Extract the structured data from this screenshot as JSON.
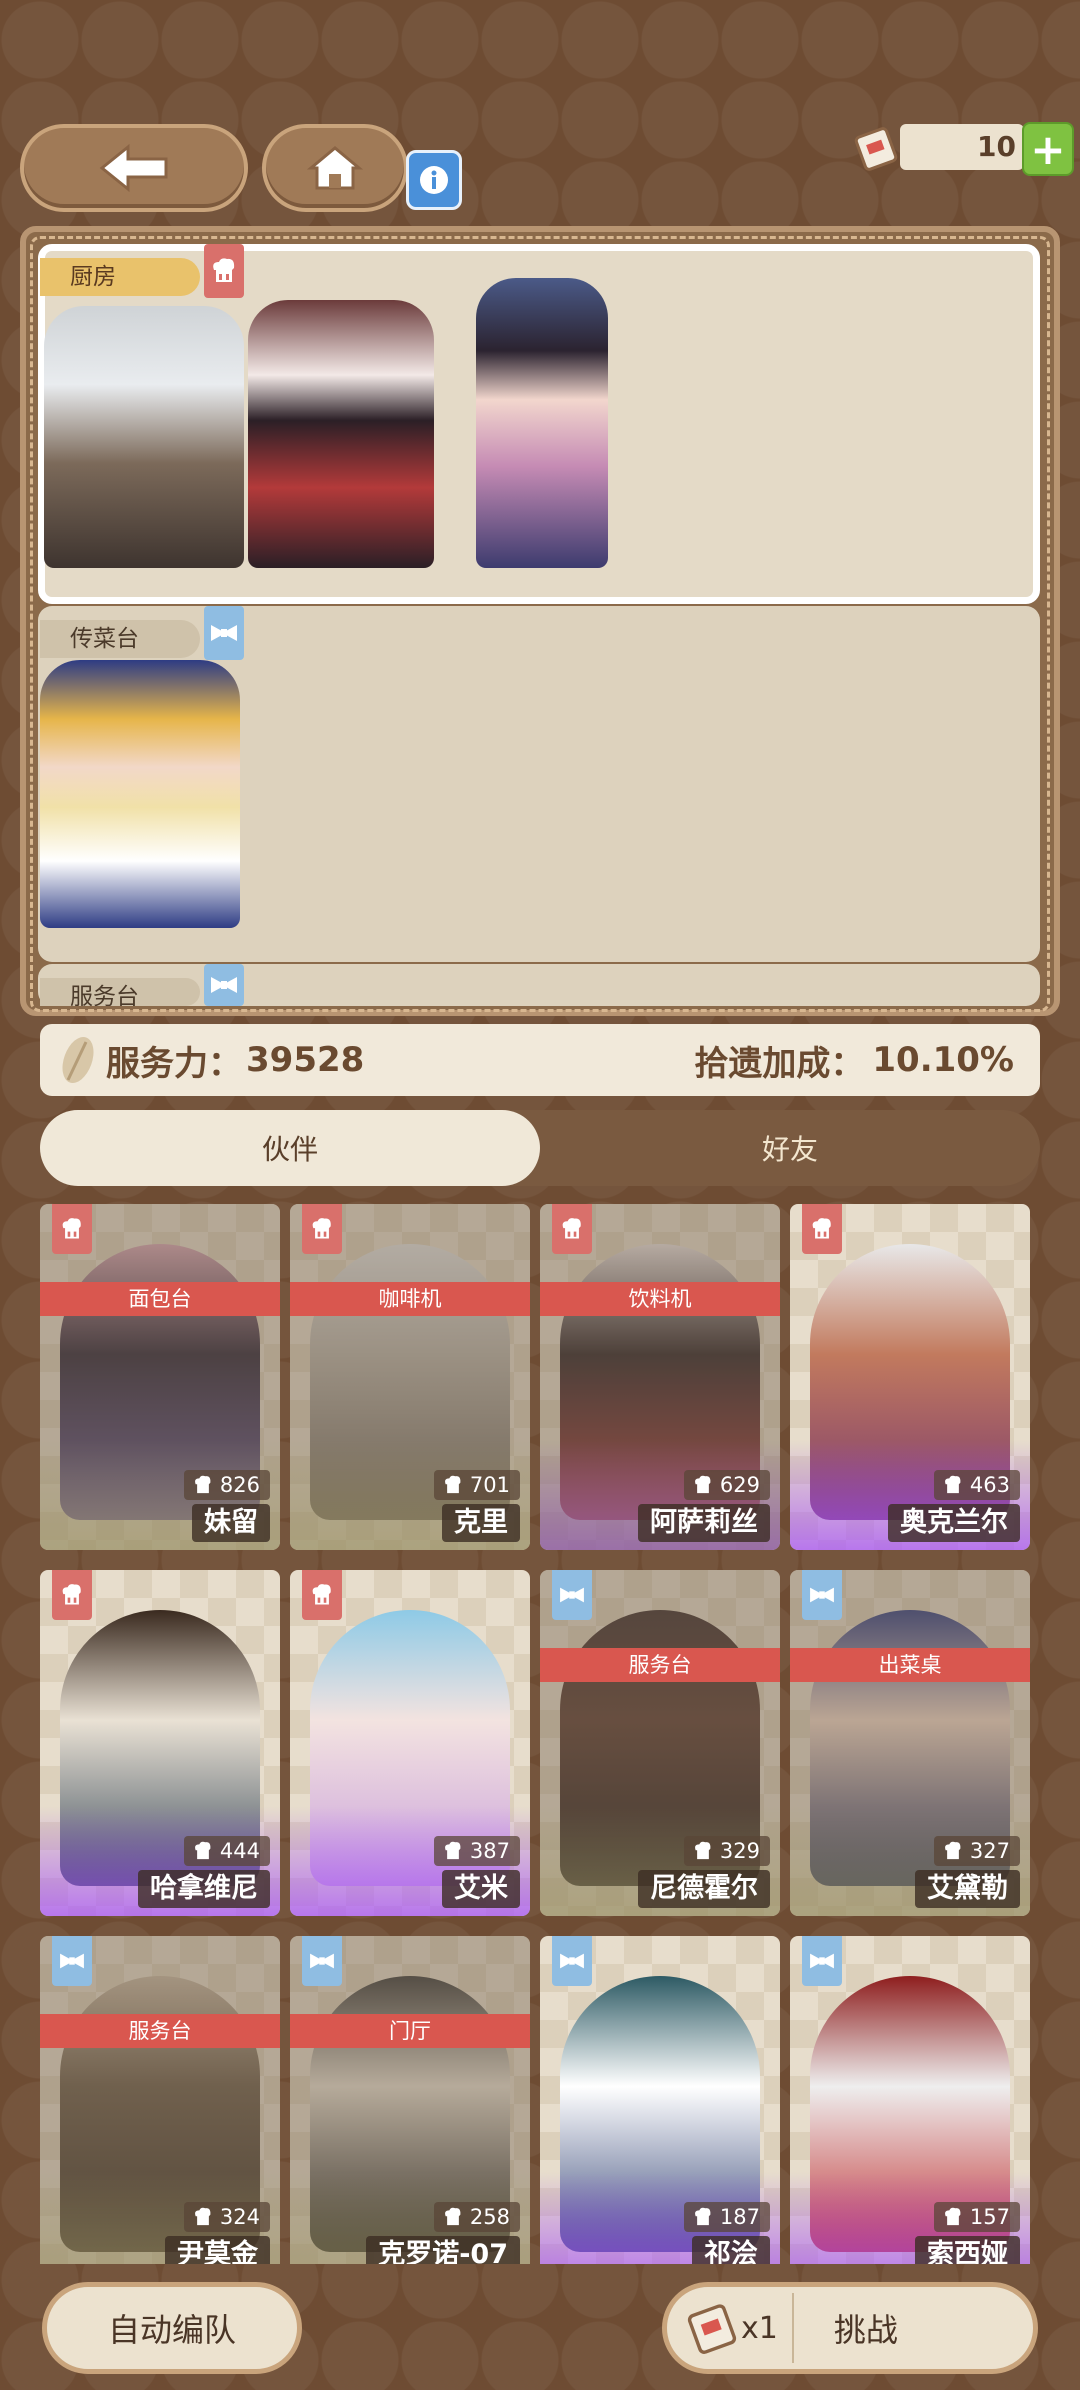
{
  "colors": {
    "accent_red": "#d9574f",
    "accent_blue": "#8fbde2",
    "bg_brown": "#6e4c33",
    "plus_green": "#7fc241"
  },
  "header": {
    "back_icon": "back-arrow-icon",
    "home_icon": "home-icon",
    "info_icon": "info-icon",
    "ticket_icon": "ticket-icon",
    "ticket_count": "10",
    "plus_label": "+"
  },
  "stations": [
    {
      "name": "厨房",
      "icon": "chef-hat-icon",
      "selected": true
    },
    {
      "name": "传菜台",
      "icon": "bowtie-icon",
      "selected": false
    },
    {
      "name": "服务台",
      "icon": "bowtie-icon",
      "selected": false
    }
  ],
  "stats": {
    "service_label": "服务力：",
    "service_value": "39528",
    "bonus_label": "拾遗加成：",
    "bonus_value": "10.10%"
  },
  "tabs": [
    {
      "label": "伙伴",
      "active": true
    },
    {
      "label": "好友",
      "active": false
    }
  ],
  "cards": [
    {
      "name": "妹留",
      "power": "826",
      "role": "chef",
      "assigned": "面包台",
      "dim": true
    },
    {
      "name": "克里",
      "power": "701",
      "role": "chef",
      "assigned": "咖啡机",
      "dim": true
    },
    {
      "name": "阿萨莉丝",
      "power": "629",
      "role": "chef",
      "assigned": "饮料机",
      "dim": true
    },
    {
      "name": "奥克兰尔",
      "power": "463",
      "role": "chef",
      "assigned": "",
      "dim": false
    },
    {
      "name": "哈拿维尼",
      "power": "444",
      "role": "chef",
      "assigned": "",
      "dim": false
    },
    {
      "name": "艾米",
      "power": "387",
      "role": "chef",
      "assigned": "",
      "dim": false
    },
    {
      "name": "尼德霍尔",
      "power": "329",
      "role": "waiter",
      "assigned": "服务台",
      "dim": true
    },
    {
      "name": "艾黛勒",
      "power": "327",
      "role": "waiter",
      "assigned": "出菜桌",
      "dim": true
    },
    {
      "name": "尹莫金",
      "power": "324",
      "role": "waiter",
      "assigned": "服务台",
      "dim": true
    },
    {
      "name": "克罗诺-07",
      "power": "258",
      "role": "waiter",
      "assigned": "门厅",
      "dim": true
    },
    {
      "name": "祁浍",
      "power": "187",
      "role": "waiter",
      "assigned": "",
      "dim": false
    },
    {
      "name": "索西娅",
      "power": "157",
      "role": "waiter",
      "assigned": "",
      "dim": false
    }
  ],
  "footer": {
    "auto_team_label": "自动编队",
    "ticket_cost": "x1",
    "challenge_label": "挑战"
  }
}
